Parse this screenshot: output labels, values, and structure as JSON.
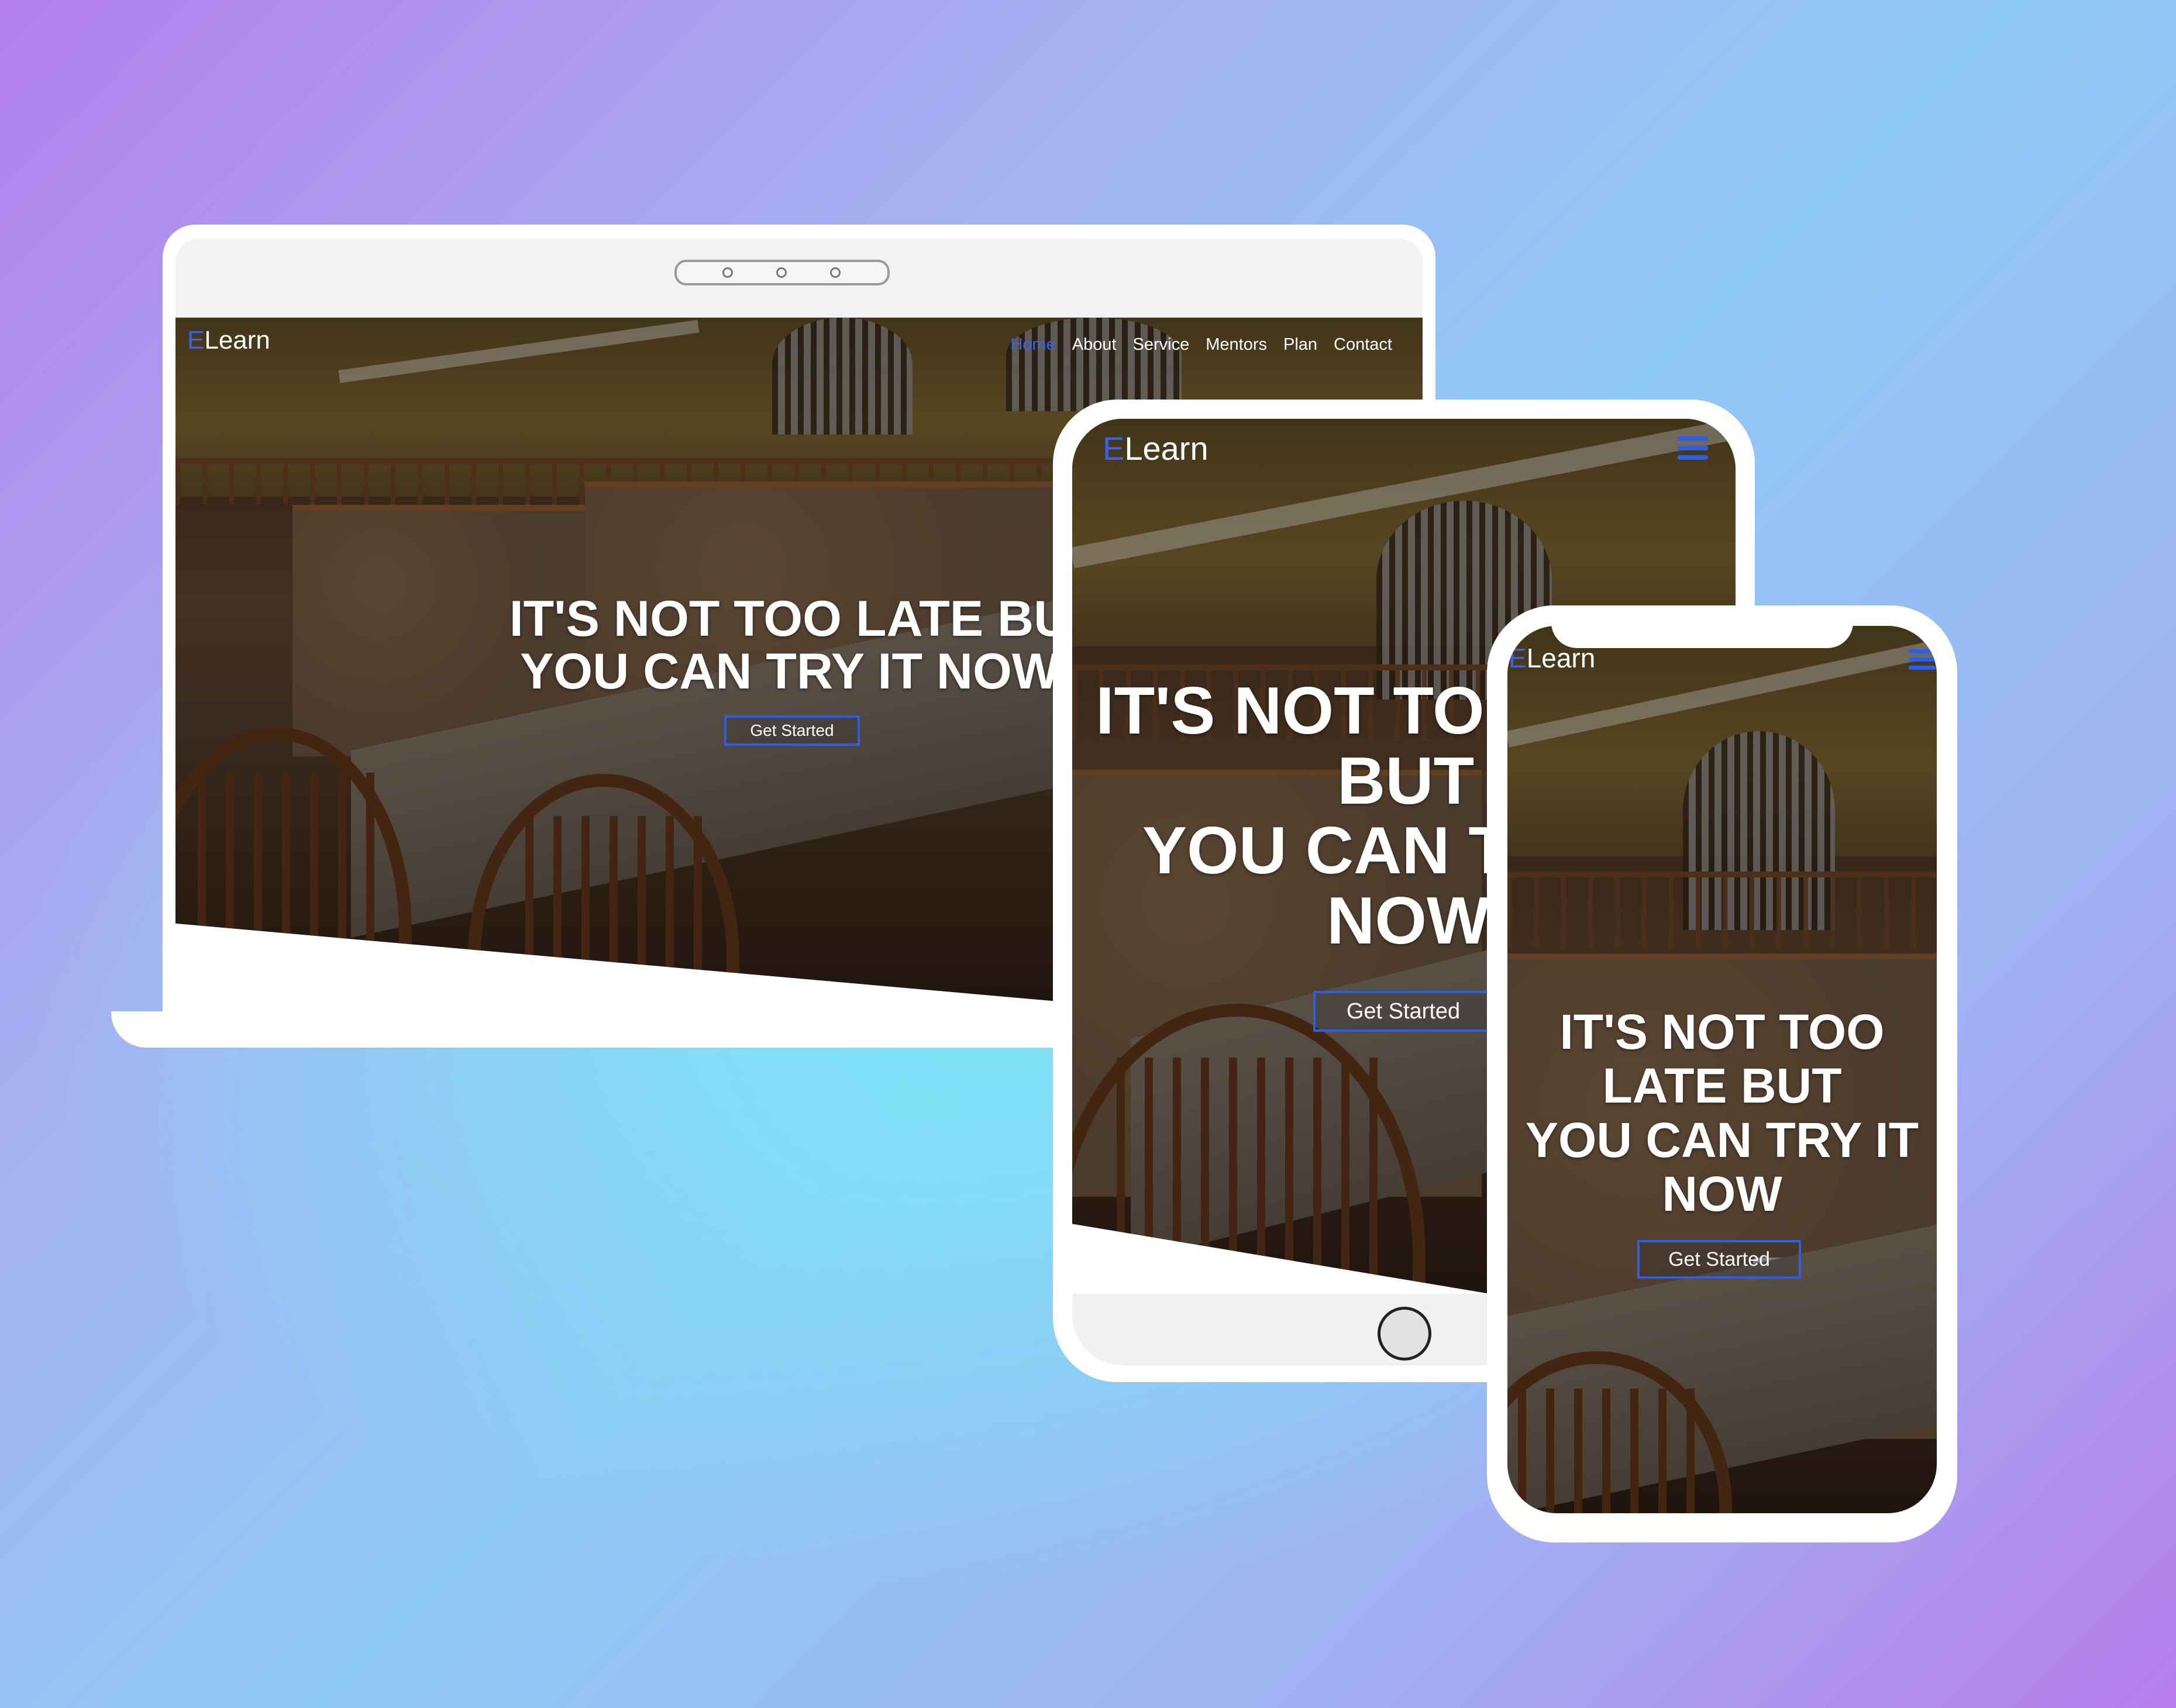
{
  "brand": {
    "prefix": "E",
    "rest": "Learn",
    "accent": "#3a62e6"
  },
  "nav": {
    "items": [
      "Home",
      "About",
      "Service",
      "Mentors",
      "Plan",
      "Contact"
    ],
    "active": "Home"
  },
  "hero": {
    "laptop_lines": [
      "IT'S NOT TOO LATE BU",
      "YOU CAN TRY IT NOW"
    ],
    "tablet_lines": [
      "IT'S NOT TOO",
      "BUT",
      "YOU CAN T",
      "NOW"
    ],
    "phone_lines": [
      "IT'S NOT TOO",
      "LATE BUT",
      "YOU CAN TRY IT",
      "NOW"
    ],
    "cta_label": "Get Started"
  },
  "icons": {
    "menu": "hamburger-menu-icon",
    "camera": "camera-dots-icon",
    "home_button": "home-button-icon"
  },
  "colors": {
    "button_border": "#2f5ee0",
    "background_start": "#b47fec",
    "background_mid": "#7ee4f7"
  }
}
